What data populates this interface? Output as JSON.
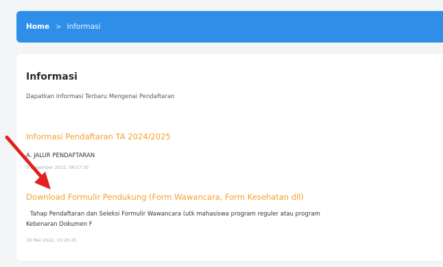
{
  "breadcrumb": {
    "home": "Home",
    "separator": ">",
    "current": "Informasi"
  },
  "page": {
    "title": "Informasi",
    "subtitle": "Dapatkan Informasi Terbaru Mengenai Pendaftaran"
  },
  "items": [
    {
      "title": "Informasi Pendaftaran TA 2024/2025",
      "body": "A. JALUR PENDAFTARAN",
      "date": "3 Desember 2022, 08:57:35"
    },
    {
      "title": "Download Formulir Pendukung (Form Wawancara, Form Kesehatan dll)",
      "body_line1": "Tahap Pendaftaran dan Seleksi Formulir Wawancara  (utk mahasiswa program reguler atau program",
      "body_line2": "Kebenaran Dokumen F",
      "date": "19 Mei 2022, 10:26:35"
    }
  ],
  "colors": {
    "breadcrumb_bg": "#2f8fe8",
    "link_orange": "#f5a02a",
    "arrow_red": "#e0211d"
  }
}
